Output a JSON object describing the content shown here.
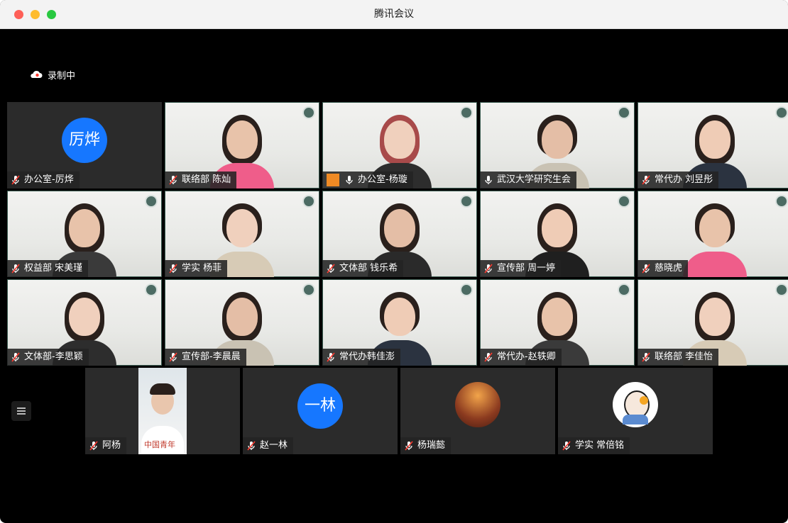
{
  "window": {
    "title": "腾讯会议"
  },
  "recording": {
    "label": "录制中",
    "icon": "cloud-icon"
  },
  "colors": {
    "accent": "#1677ff",
    "tile_bg": "#2b2b2b",
    "window_bg": "#000000"
  },
  "participants": [
    {
      "name": "办公室-厉烨",
      "video": false,
      "avatar_text": "厉烨",
      "mic": "muted"
    },
    {
      "name": "联络部 陈灿",
      "video": true,
      "mic": "muted"
    },
    {
      "name": "办公室-杨璇",
      "video": true,
      "mic": "speaking",
      "avatar_badge": true
    },
    {
      "name": "武汉大学研究生会",
      "video": true,
      "mic": "speaking"
    },
    {
      "name": "常代办 刘昱彤",
      "video": true,
      "mic": "muted"
    },
    {
      "name": "权益部 宋美瑾",
      "video": true,
      "mic": "muted"
    },
    {
      "name": "学实 杨菲",
      "video": true,
      "mic": "muted"
    },
    {
      "name": "文体部 钱乐希",
      "video": true,
      "mic": "muted"
    },
    {
      "name": "宣传部 周一婷",
      "video": true,
      "mic": "muted"
    },
    {
      "name": "慈晓虎",
      "video": true,
      "mic": "muted"
    },
    {
      "name": "文体部-李思颖",
      "video": true,
      "mic": "muted"
    },
    {
      "name": "宣传部-李晨晨",
      "video": true,
      "mic": "muted"
    },
    {
      "name": "常代办韩佳澎",
      "video": true,
      "mic": "muted"
    },
    {
      "name": "常代办-赵轶卿",
      "video": true,
      "mic": "muted"
    },
    {
      "name": "联络部 李佳怡",
      "video": true,
      "mic": "muted"
    },
    {
      "name": "阿杨",
      "video": false,
      "avatar_photo": true,
      "mic": "muted"
    },
    {
      "name": "赵一林",
      "video": false,
      "avatar_text": "一林",
      "mic": "muted"
    },
    {
      "name": "杨瑞懿",
      "video": false,
      "avatar_photo": true,
      "mic": "muted"
    },
    {
      "name": "学实 常倍铭",
      "video": false,
      "avatar_photo": true,
      "mic": "muted"
    }
  ],
  "sidebar": {
    "toggle_icon": "list-icon"
  }
}
